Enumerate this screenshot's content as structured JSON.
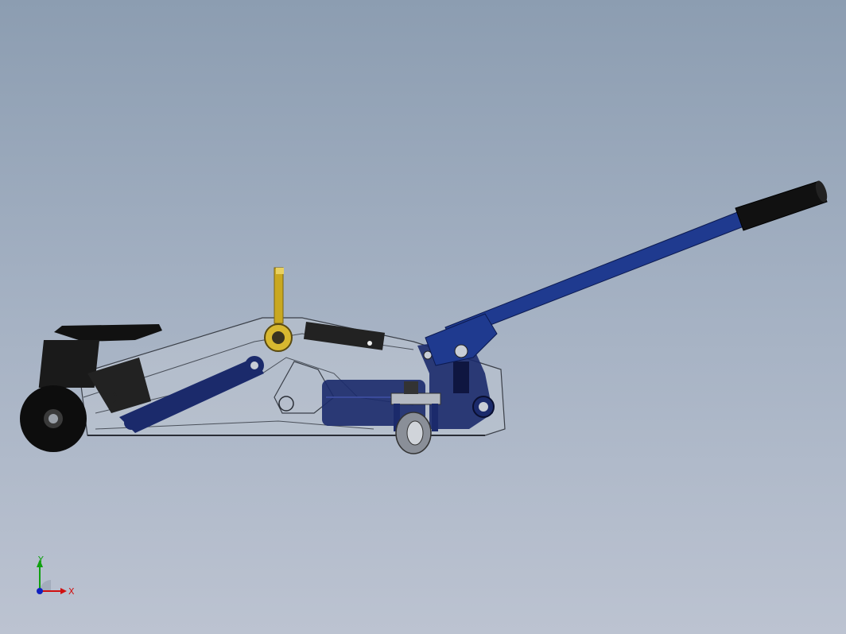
{
  "viewport": {
    "background_top": "#8c9db1",
    "background_bottom": "#bcc3d1"
  },
  "model": {
    "parts": [
      {
        "name": "saddle",
        "color": "#111111"
      },
      {
        "name": "front-wheel",
        "color": "#0d0d0d"
      },
      {
        "name": "frame",
        "color": "#c8cdd6"
      },
      {
        "name": "lift-arm",
        "color": "#1b2a6b"
      },
      {
        "name": "release-lever",
        "color": "#c9a820"
      },
      {
        "name": "hydraulic-pump",
        "color": "#1b2a6b"
      },
      {
        "name": "rear-caster",
        "color": "#8a8f98"
      },
      {
        "name": "handle",
        "color": "#1f3a8f"
      },
      {
        "name": "handle-grip",
        "color": "#111111"
      }
    ]
  },
  "triad": {
    "x_label": "X",
    "y_label": "Y",
    "x_color": "#d01010",
    "y_color": "#10a010",
    "z_color": "#1020c0"
  }
}
